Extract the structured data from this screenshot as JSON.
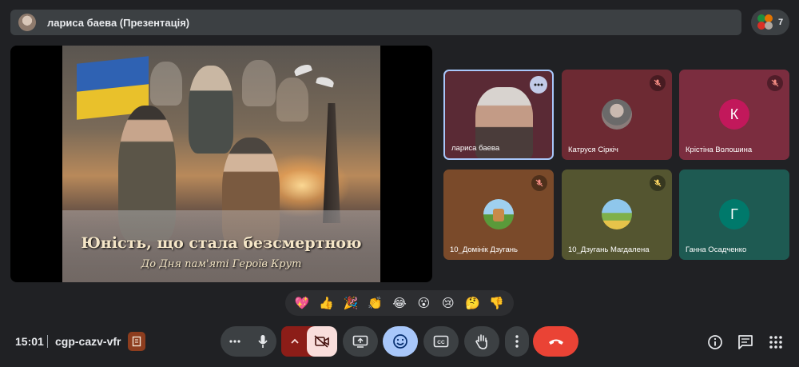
{
  "presenter_bar": {
    "title": "лариса баева (Презентація)",
    "avatar_icon": "user-avatar"
  },
  "people_count": "7",
  "slide": {
    "title": "Юність, що стала безсмертною",
    "subtitle": "До Дня пам'яті Героїв Крут"
  },
  "participants": [
    {
      "name": "лариса баева",
      "type": "video",
      "muted": false,
      "has_more_menu": true
    },
    {
      "name": "Катруся Сіркіч",
      "type": "photo",
      "muted": true,
      "tile_color": "#6d2a33"
    },
    {
      "name": "Крістіна Волошина",
      "type": "letter",
      "letter": "К",
      "muted": true,
      "tile_color": "#7b2d3f",
      "avatar_color": "#c2185b"
    },
    {
      "name": "10_Домінік Дзугань",
      "type": "photo",
      "muted": true,
      "tile_color": "#7a4a2a"
    },
    {
      "name": "10_Дзугань Магдалена",
      "type": "photo",
      "muted": true,
      "tile_color": "#545530"
    },
    {
      "name": "Ганна Осадченко",
      "type": "letter",
      "letter": "Г",
      "muted": false,
      "tile_color": "#1e5a52",
      "avatar_color": "#00796b"
    }
  ],
  "reactions": [
    "💖",
    "👍",
    "🎉",
    "👏",
    "😂",
    "😮",
    "😢",
    "🤔",
    "👎"
  ],
  "footer": {
    "time": "15:01",
    "meeting_code": "cgp-cazv-vfr"
  },
  "colors": {
    "end_call": "#ea4335",
    "camera_off": "#f9dedc",
    "reactions_active": "#a8c7fa",
    "mic_muted": "#8c1d18"
  }
}
